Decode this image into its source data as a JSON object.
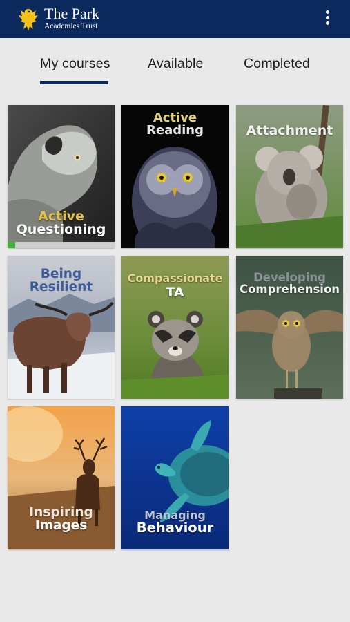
{
  "app": {
    "logo_main": "The Park",
    "logo_sub": "Academies Trust"
  },
  "tabs": [
    {
      "label": "My courses",
      "active": true
    },
    {
      "label": "Available",
      "active": false
    },
    {
      "label": "Completed",
      "active": false
    }
  ],
  "colors": {
    "brand": "#0c2a5e",
    "progress": "#3fb239"
  },
  "courses": [
    {
      "line1": "Active",
      "line2": "Questioning",
      "animal": "grey parrot",
      "progress": 0.07
    },
    {
      "line1": "Active",
      "line2": "Reading",
      "animal": "great grey owl",
      "progress": 0
    },
    {
      "line1": "",
      "line2": "Attachment",
      "animal": "koala with baby",
      "progress": 0
    },
    {
      "line1": "Being",
      "line2": "Resilient",
      "animal": "highland cow",
      "progress": 0
    },
    {
      "line1": "Compassionate",
      "line2": "TA",
      "animal": "raccoon",
      "progress": 0
    },
    {
      "line1": "Developing",
      "line2": "Comprehension",
      "animal": "burrowing owl",
      "progress": 0
    },
    {
      "line1": "Inspiring",
      "line2": "Images",
      "animal": "red deer stag",
      "progress": 0
    },
    {
      "line1": "Managing",
      "line2": "Behaviour",
      "animal": "sea turtle",
      "progress": 0
    }
  ]
}
